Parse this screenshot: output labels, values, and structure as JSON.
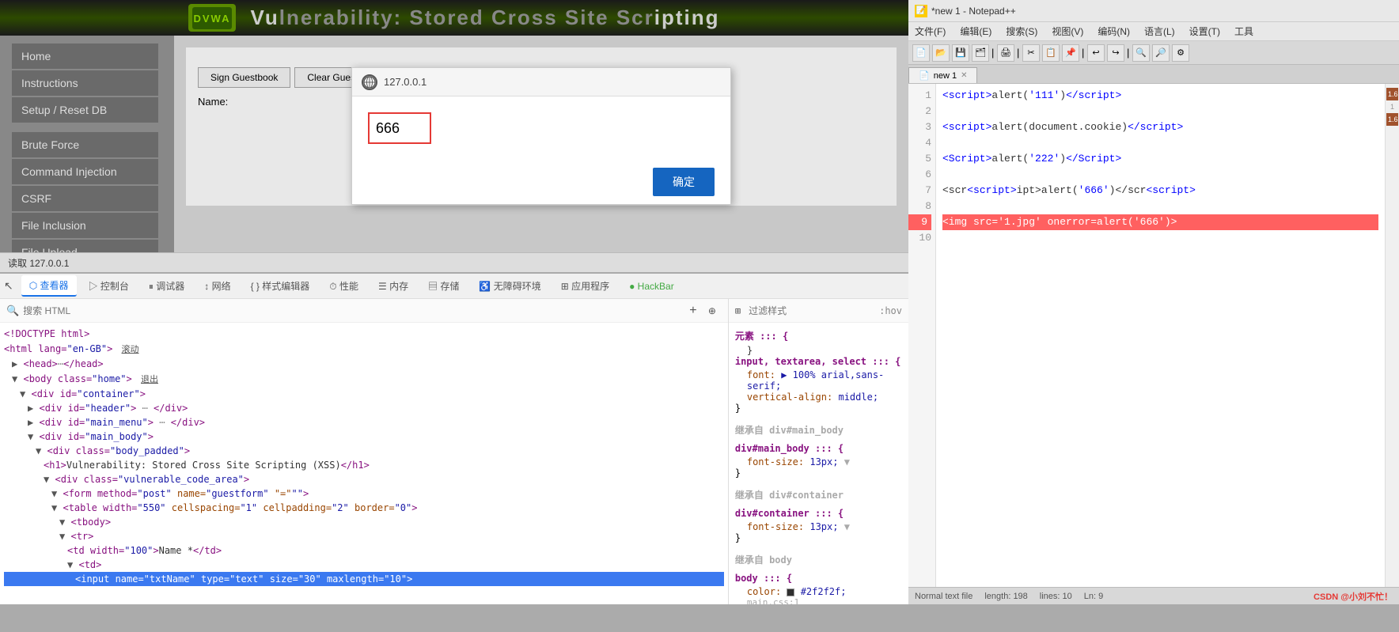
{
  "notepad": {
    "title": "*new 1 - Notepad++",
    "tab_label": "new 1",
    "menu": [
      "文件(F)",
      "编辑(E)",
      "搜索(S)",
      "视图(V)",
      "编码(N)",
      "语言(L)",
      "设置(T)",
      "工具"
    ],
    "code_lines": [
      "<script>alert('111')<\\/script>",
      "",
      "<script>alert(document.cookie)<\\/script>",
      "",
      "<Script>alert('222')<\\/Script>",
      "",
      "<scr<script>ipt>alert('666')<\\/scr<script>",
      "",
      "<img src='1.jpg' onerror=alert('666')>",
      ""
    ],
    "status": {
      "file_type": "Normal text file",
      "length": "length: 198",
      "lines": "lines: 10",
      "ln": "Ln: 9"
    },
    "scrollbar_markers": [
      "1.6❥",
      "1",
      "1.6"
    ]
  },
  "alert_dialog": {
    "host": "127.0.0.1",
    "value": "666",
    "ok_btn": "确定"
  },
  "nav": {
    "items": [
      {
        "label": "Home",
        "active": false
      },
      {
        "label": "Instructions",
        "active": false
      },
      {
        "label": "Setup / Reset DB",
        "active": false
      },
      {
        "label": "Brute Force",
        "active": false
      },
      {
        "label": "Command Injection",
        "active": false
      },
      {
        "label": "CSRF",
        "active": false
      },
      {
        "label": "File Inclusion",
        "active": false
      },
      {
        "label": "File Upload",
        "active": false
      }
    ]
  },
  "dvwa": {
    "title": "Vulnerability: Stored Cross Site Scripting (XSS)"
  },
  "devtools": {
    "tabs": [
      "查看器",
      "控制台",
      "调试器",
      "网络",
      "样式编辑器",
      "性能",
      "内存",
      "存储",
      "无障碍环境",
      "应用程序",
      "HackBar"
    ],
    "active_tab": "查看器",
    "search_placeholder": "搜索 HTML",
    "html_content": [
      {
        "indent": 0,
        "content": "<!DOCTYPE html>"
      },
      {
        "indent": 0,
        "content": "<html lang=\"en-GB\"> 滚动"
      },
      {
        "indent": 0,
        "content": "▶ <head>⋯</head>"
      },
      {
        "indent": 0,
        "content": "▼ <body class=\"home\"> 退出"
      },
      {
        "indent": 1,
        "content": "▼ <div id=\"container\">"
      },
      {
        "indent": 2,
        "content": "▶ <div id=\"header\"> ⋯ </div>"
      },
      {
        "indent": 2,
        "content": "▶ <div id=\"main_menu\"> ⋯ </div>"
      },
      {
        "indent": 2,
        "content": "▼ <div id=\"main_body\">"
      },
      {
        "indent": 3,
        "content": "▼ <div class=\"body_padded\">"
      },
      {
        "indent": 4,
        "content": "<h1>Vulnerability: Stored Cross Site Scripting (XSS)</h1>"
      },
      {
        "indent": 4,
        "content": "▼ <div class=\"vulnerable_code_area\">"
      },
      {
        "indent": 5,
        "content": "▼ <form method=\"post\" name=\"guestform\" \"=\"\">"
      },
      {
        "indent": 6,
        "content": "▼ <table width=\"550\" cellspacing=\"1\" cellpadding=\"2\" border=\"0\">"
      },
      {
        "indent": 7,
        "content": "▼ <tbody>"
      },
      {
        "indent": 7,
        "content": "▼ <tr>"
      },
      {
        "indent": 8,
        "content": "<td width=\"100\">Name *</td>"
      },
      {
        "indent": 8,
        "content": "▼ <td>"
      },
      {
        "indent": 9,
        "content": "<input name=\"txtName\" type=\"text\" size=\"30\" maxlength=\"10\">",
        "selected": true
      }
    ]
  },
  "styles": {
    "filter_placeholder": "过滤样式",
    "sections": [
      {
        "selector": "元素 ::: {",
        "props": [
          "}",
          "input, textarea, select ::: {",
          "  font: ▶ 100% arial,sans-serif;",
          "  vertical-align: middle;",
          "}"
        ]
      },
      {
        "inherited_from": "继承自 div#main_body",
        "props": [
          "div#main_body ::: {",
          "  font-size: 13px; ▼",
          "}"
        ]
      },
      {
        "inherited_from": "继承自 div#container",
        "props": [
          "div#container ::: {",
          "  font-size: 13px; ▼",
          "}"
        ]
      },
      {
        "inherited_from": "继承自 body",
        "props": [
          "body ::: {",
          "  color: ● #2f2f2f;",
          "  main.css:1"
        ]
      }
    ]
  },
  "status_bar": {
    "text": "读取 127.0.0.1"
  },
  "guestbook": {
    "sign_btn": "Sign Guestbook",
    "clear_btn": "Clear Guestbook",
    "name_label": "Name:"
  }
}
